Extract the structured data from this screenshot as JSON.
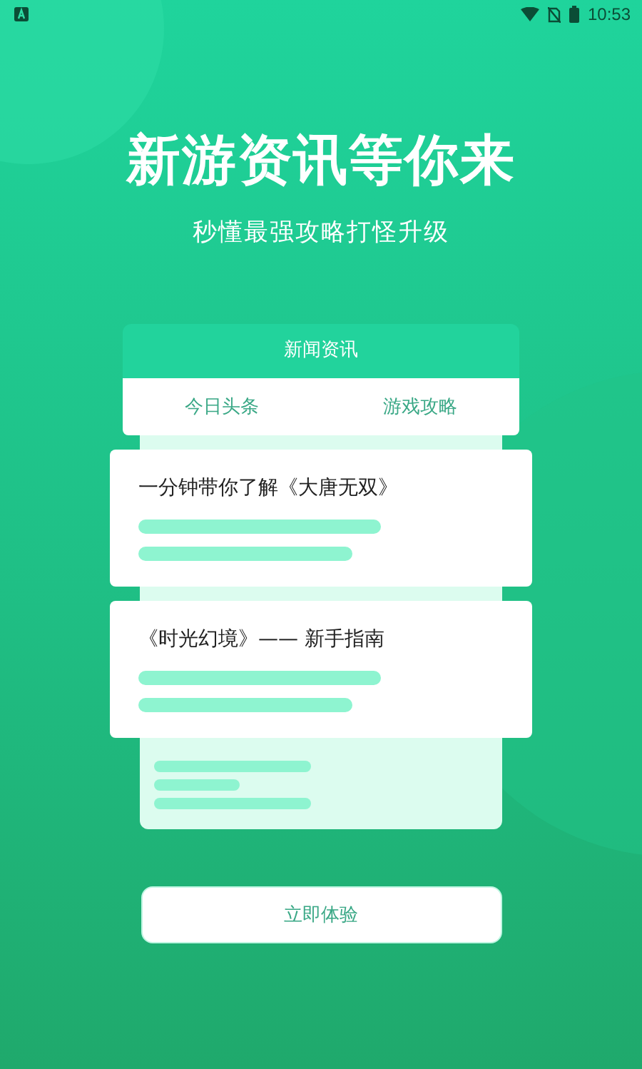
{
  "status_bar": {
    "time": "10:53"
  },
  "headline": "新游资讯等你来",
  "subheadline": "秒懂最强攻略打怪升级",
  "card": {
    "title": "新闻资讯",
    "tabs": [
      {
        "label": "今日头条"
      },
      {
        "label": "游戏攻略"
      }
    ],
    "articles": [
      {
        "title": "一分钟带你了解《大唐无双》"
      },
      {
        "title": "《时光幻境》—— 新手指南"
      }
    ]
  },
  "button": "立即体验"
}
